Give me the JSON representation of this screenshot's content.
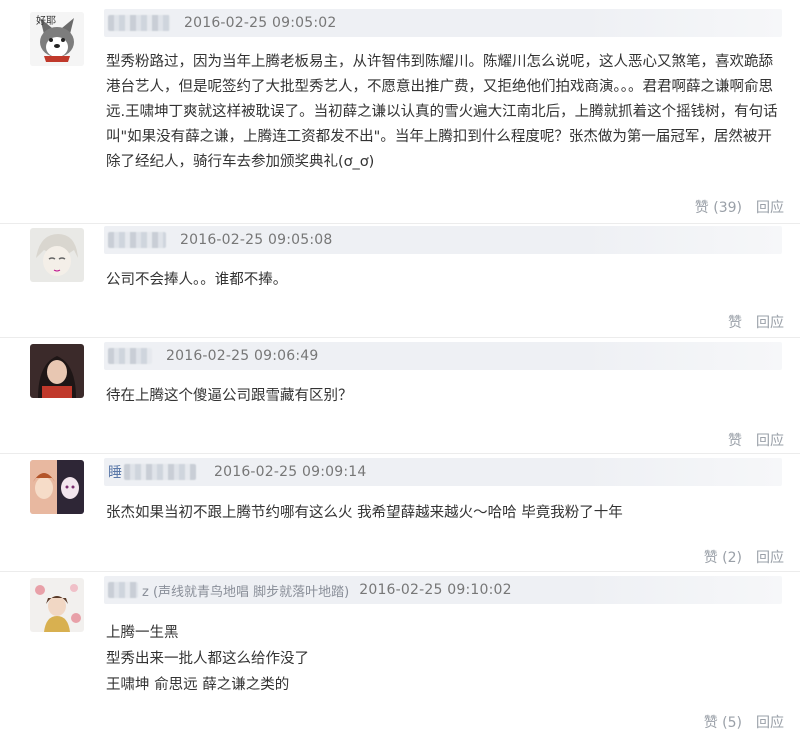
{
  "comments": [
    {
      "avatar_icon": "husky-dog-avatar",
      "avatar_badge": "好耶",
      "name_prefix": "",
      "name_note": "",
      "time": "2016-02-25 09:05:02",
      "text": "型秀粉路过，因为当年上腾老板易主，从许智伟到陈耀川。陈耀川怎么说呢，这人恶心又煞笔，喜欢跪舔港台艺人，但是呢签约了大批型秀艺人，不愿意出推广费，又拒绝他们拍戏商演。。。君君啊薛之谦啊俞思远.王啸坤丁爽就这样被耽误了。当初薛之谦以认真的雪火遍大江南北后，上腾就抓着这个摇钱树，有句话叫\"如果没有薛之谦，上腾连工资都发不出\"。当年上腾扣到什么程度呢？张杰做为第一届冠军，居然被开除了经纪人，骑行车去参加颁奖典礼(ơ_ơ)",
      "like_label": "赞 (39)",
      "reply_label": "回应"
    },
    {
      "avatar_icon": "anime-boy-avatar",
      "avatar_badge": "",
      "name_prefix": "",
      "name_note": "",
      "time": "2016-02-25 09:05:08",
      "text": "公司不会捧人。。谁都不捧。",
      "like_label": "赞",
      "reply_label": "回应"
    },
    {
      "avatar_icon": "girl-photo-avatar",
      "avatar_badge": "",
      "name_prefix": "",
      "name_note": "",
      "time": "2016-02-25 09:06:49",
      "text": "待在上腾这个傻逼公司跟雪藏有区别？",
      "like_label": "赞",
      "reply_label": "回应"
    },
    {
      "avatar_icon": "anime-girls-avatar",
      "avatar_badge": "",
      "name_prefix": "睡",
      "name_note": "",
      "time": "2016-02-25 09:09:14",
      "text": "张杰如果当初不跟上腾节约哪有这么火 我希望薛越来越火～哈哈 毕竟我粉了十年",
      "like_label": "赞 (2)",
      "reply_label": "回应"
    },
    {
      "avatar_icon": "girl-flowers-avatar",
      "avatar_badge": "",
      "name_prefix": "",
      "name_note": "z (声线就青鸟地唱 脚步就落叶地踏)",
      "time": "2016-02-25 09:10:02",
      "text": "上腾一生黑\n型秀出来一批人都这么给作没了\n王啸坤 俞思远 薛之谦之类的",
      "like_label": "赞 (5)",
      "reply_label": "回应"
    }
  ]
}
